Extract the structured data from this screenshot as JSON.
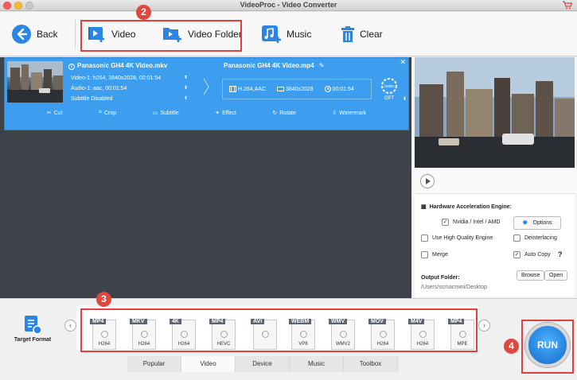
{
  "window": {
    "title": "VideoProc - Video Converter"
  },
  "toolbar": {
    "back_label": "Back",
    "video_label": "Video",
    "video_folder_label": "Video Folder",
    "music_label": "Music",
    "clear_label": "Clear"
  },
  "badges": {
    "b2": "2",
    "b3": "3",
    "b4": "4"
  },
  "item": {
    "source_name": "Panasonic GH4 4K Video.mkv",
    "video_track": "Video-1: h264, 3840x2028, 00:01:54",
    "audio_track": "Audio-1: aac, 00:01:54",
    "subtitle": "Subtitle Disabled",
    "output_name": "Panasonic GH4 4K Video.mp4",
    "codec": "H.264,AAC",
    "resolution": "3840x2028",
    "duration": "00:01:54",
    "opt_label": "OPT",
    "codec_label": "codec"
  },
  "edit_bar": {
    "cut": "Cut",
    "crop": "Crop",
    "subtitle": "Subtitle",
    "effect": "Effect",
    "rotate": "Rotate",
    "watermark": "Watermark"
  },
  "settings": {
    "hw_title": "Hardware Acceleration Engine:",
    "nvidia": "Nvidia / Intel / AMD",
    "options": "Options",
    "high_quality": "Use High Quality Engine",
    "deinterlacing": "Deinterlacing",
    "merge": "Merge",
    "auto_copy": "Auto Copy",
    "help": "?",
    "output_folder_label": "Output Folder:",
    "output_path": "/Users/scmacmini/Desktop",
    "browse": "Browse",
    "open": "Open"
  },
  "checkboxes": {
    "nvidia": true,
    "high_quality": false,
    "deinterlacing": false,
    "merge": false,
    "auto_copy": true
  },
  "bottom": {
    "target_format": "Target Format",
    "formats": [
      {
        "label": "MP4",
        "codec": "H264"
      },
      {
        "label": "MKV",
        "codec": "H264"
      },
      {
        "label": "4K",
        "codec": "H264"
      },
      {
        "label": "MP4",
        "codec": "HEVC"
      },
      {
        "label": "AVI",
        "codec": ""
      },
      {
        "label": "WEBM",
        "codec": "VP8"
      },
      {
        "label": "WMV",
        "codec": "WMV2"
      },
      {
        "label": "MOV",
        "codec": "H264"
      },
      {
        "label": "M4V",
        "codec": "H264"
      },
      {
        "label": "MP4",
        "codec": "MPE"
      }
    ],
    "tabs": [
      "Popular",
      "Video",
      "Device",
      "Music",
      "Toolbox"
    ],
    "active_tab": "Video",
    "run_label": "RUN"
  },
  "colors": {
    "accent": "#3d9ef0",
    "highlight": "#e53e3e",
    "badge": "#e0473d"
  }
}
